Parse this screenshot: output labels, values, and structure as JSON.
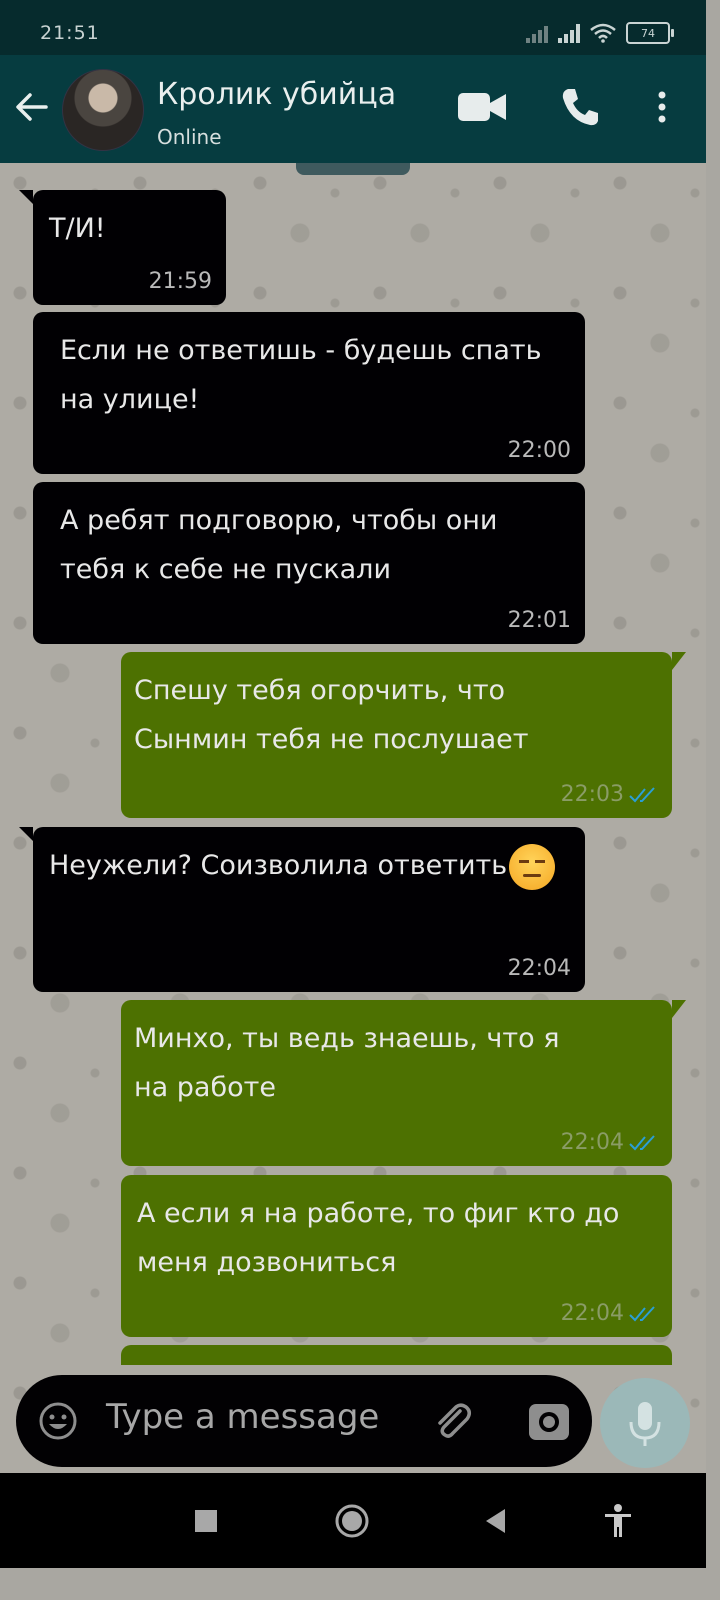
{
  "status_bar": {
    "time": "21:51",
    "battery": "74"
  },
  "header": {
    "contact_name": "Кролик убийца",
    "contact_status": "Online"
  },
  "messages": [
    {
      "direction": "in",
      "text": "Т/И!",
      "time": "21:59"
    },
    {
      "direction": "in",
      "text": "Если не ответишь - будешь спать на улице!",
      "time": "22:00"
    },
    {
      "direction": "in",
      "text": "А ребят подговорю, чтобы они тебя к себе не пускали",
      "time": "22:01"
    },
    {
      "direction": "out",
      "text": "Спешу тебя огорчить, что Сынмин тебя не послушает",
      "time": "22:03"
    },
    {
      "direction": "in",
      "text": "Неужели? Соизволила ответить",
      "time": "22:04"
    },
    {
      "direction": "out",
      "text": "Минхо, ты ведь знаешь, что я на работе",
      "time": "22:04"
    },
    {
      "direction": "out",
      "text": "А если я на работе, то фиг кто до меня дозвониться",
      "time": "22:04"
    }
  ],
  "input": {
    "placeholder": "Type a message"
  },
  "colors": {
    "header": "#063c40",
    "incoming_bubble": "#010003",
    "outgoing_bubble": "#4d7101",
    "read_ticks": "#2a9fd6"
  },
  "icons": [
    "back-arrow-icon",
    "video-call-icon",
    "phone-icon",
    "more-vertical-icon",
    "emoji-icon",
    "attach-icon",
    "camera-icon",
    "mic-icon",
    "nav-square-icon",
    "nav-home-icon",
    "nav-back-icon",
    "accessibility-icon"
  ]
}
